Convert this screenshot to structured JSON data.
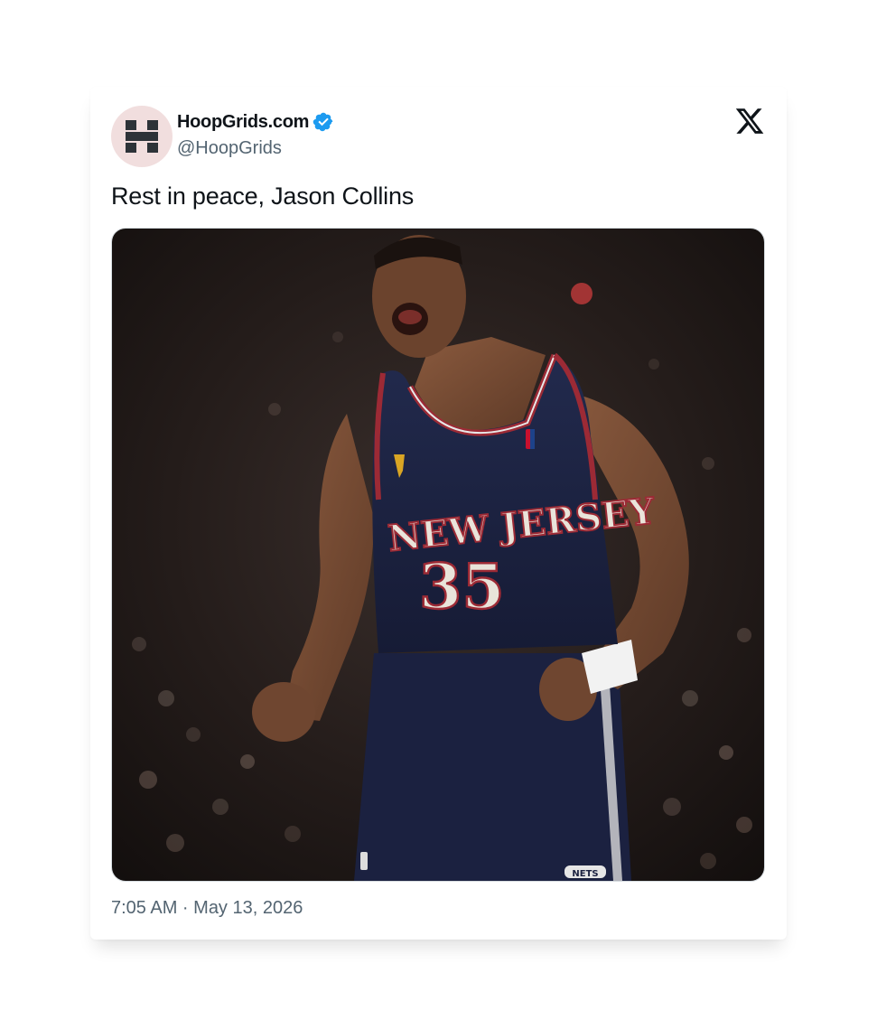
{
  "tweet": {
    "display_name": "HoopGrids.com",
    "handle": "@HoopGrids",
    "verified": true,
    "text": "Rest in peace, Jason Collins",
    "timestamp": "7:05 AM · May 13, 2026",
    "platform_icon": "x-logo-icon",
    "avatar_icon": "hoopgrids-h-logo",
    "media": {
      "jersey_team": "NEW JERSEY",
      "jersey_number": "35",
      "shorts_logo": "NETS"
    }
  },
  "colors": {
    "text_primary": "#0f1419",
    "text_secondary": "#536471",
    "verified_badge": "#1d9bf0",
    "avatar_bg": "#f1dede",
    "avatar_logo": "#2d3338",
    "jersey_navy": "#1b2140",
    "jersey_trim_red": "#9c2a35"
  }
}
